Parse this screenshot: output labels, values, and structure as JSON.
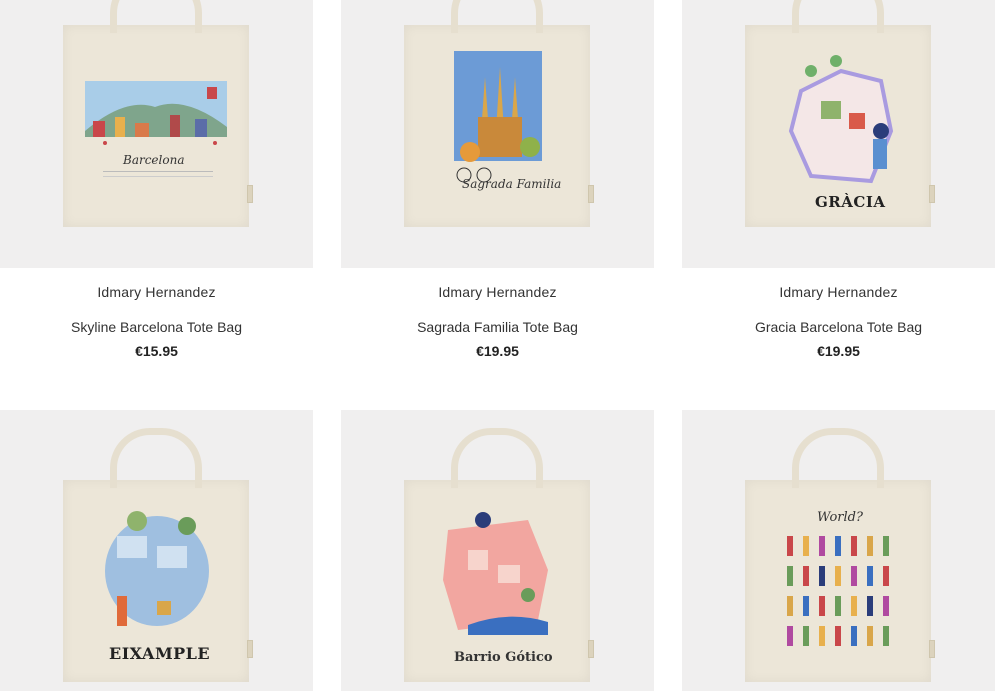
{
  "products": [
    {
      "maker": "Idmary Hernandez",
      "title": "Skyline Barcelona Tote Bag",
      "price": "€15.95",
      "art_label": "Barcelona"
    },
    {
      "maker": "Idmary Hernandez",
      "title": "Sagrada Familia Tote Bag",
      "price": "€19.95",
      "art_label": "Sagrada Familia"
    },
    {
      "maker": "Idmary Hernandez",
      "title": "Gracia Barcelona Tote Bag",
      "price": "€19.95",
      "art_label": "GRÀCIA"
    },
    {
      "art_label": "EIXAMPLE"
    },
    {
      "art_label": "Barrio Gótico"
    },
    {
      "art_label": "World?"
    }
  ],
  "colors": {
    "image_bg": "#f0efef",
    "bag": "#ece6d8",
    "text": "#333333"
  }
}
